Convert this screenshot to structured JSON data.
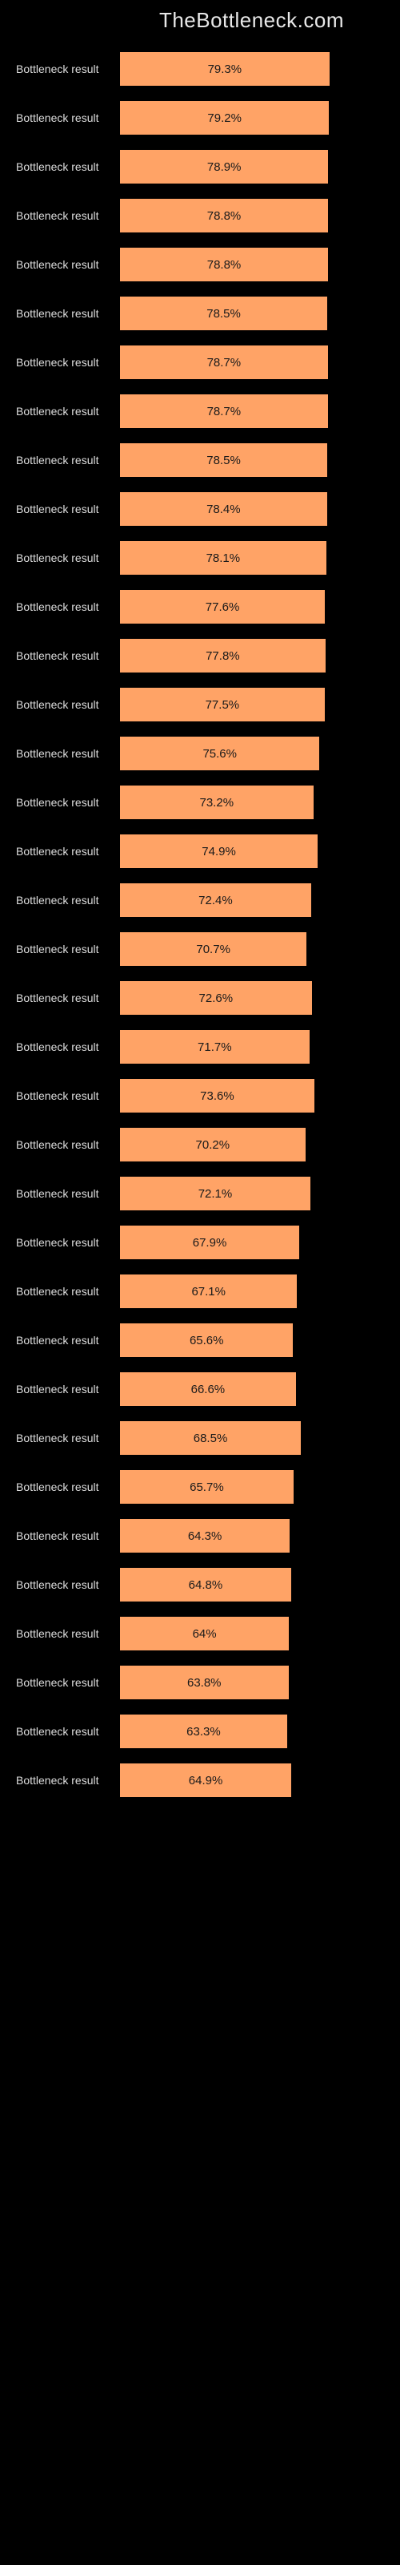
{
  "header": {
    "site_title": "TheBottleneck.com"
  },
  "chart_data": {
    "type": "bar",
    "title": "",
    "xlabel": "",
    "ylabel": "",
    "ylim": [
      0,
      100
    ],
    "bar_color": "#ffa366",
    "label_text": "Bottleneck result",
    "series": [
      {
        "name": "Bottleneck result",
        "value": 79.3
      },
      {
        "name": "Bottleneck result",
        "value": 79.2
      },
      {
        "name": "Bottleneck result",
        "value": 78.9
      },
      {
        "name": "Bottleneck result",
        "value": 78.8
      },
      {
        "name": "Bottleneck result",
        "value": 78.8
      },
      {
        "name": "Bottleneck result",
        "value": 78.5
      },
      {
        "name": "Bottleneck result",
        "value": 78.7
      },
      {
        "name": "Bottleneck result",
        "value": 78.7
      },
      {
        "name": "Bottleneck result",
        "value": 78.5
      },
      {
        "name": "Bottleneck result",
        "value": 78.4
      },
      {
        "name": "Bottleneck result",
        "value": 78.1
      },
      {
        "name": "Bottleneck result",
        "value": 77.6
      },
      {
        "name": "Bottleneck result",
        "value": 77.8
      },
      {
        "name": "Bottleneck result",
        "value": 77.5
      },
      {
        "name": "Bottleneck result",
        "value": 75.6
      },
      {
        "name": "Bottleneck result",
        "value": 73.2
      },
      {
        "name": "Bottleneck result",
        "value": 74.9
      },
      {
        "name": "Bottleneck result",
        "value": 72.4
      },
      {
        "name": "Bottleneck result",
        "value": 70.7
      },
      {
        "name": "Bottleneck result",
        "value": 72.6
      },
      {
        "name": "Bottleneck result",
        "value": 71.7
      },
      {
        "name": "Bottleneck result",
        "value": 73.6
      },
      {
        "name": "Bottleneck result",
        "value": 70.2
      },
      {
        "name": "Bottleneck result",
        "value": 72.1
      },
      {
        "name": "Bottleneck result",
        "value": 67.9
      },
      {
        "name": "Bottleneck result",
        "value": 67.1
      },
      {
        "name": "Bottleneck result",
        "value": 65.6
      },
      {
        "name": "Bottleneck result",
        "value": 66.6
      },
      {
        "name": "Bottleneck result",
        "value": 68.5
      },
      {
        "name": "Bottleneck result",
        "value": 65.7
      },
      {
        "name": "Bottleneck result",
        "value": 64.3
      },
      {
        "name": "Bottleneck result",
        "value": 64.8
      },
      {
        "name": "Bottleneck result",
        "value": 64.0,
        "display": "64%"
      },
      {
        "name": "Bottleneck result",
        "value": 63.8
      },
      {
        "name": "Bottleneck result",
        "value": 63.3
      },
      {
        "name": "Bottleneck result",
        "value": 64.9
      }
    ]
  }
}
